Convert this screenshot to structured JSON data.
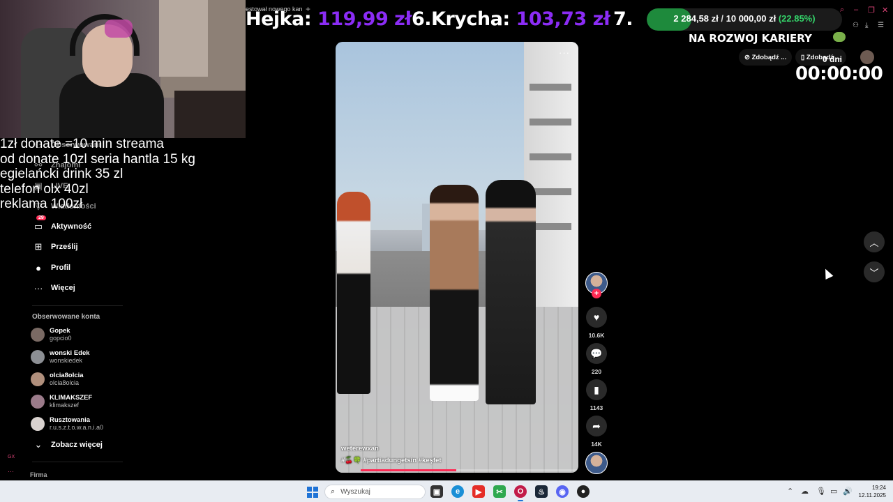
{
  "browser": {
    "tab_title": "estował nowego kan",
    "tab_add": "+"
  },
  "ticker": {
    "items": [
      {
        "name": "Hejka:",
        "amount": "119,99 zł"
      },
      {
        "name": "6.Krycha:",
        "amount": "103,73 zł"
      },
      {
        "name": "7.",
        "amount": ""
      }
    ],
    "goal": {
      "current": "2 284,58 zł",
      "separator": "/",
      "target": "10 000,00 zł",
      "percent_label": "(22.85%)",
      "progress": 0.2285,
      "caption": "NA ROZWOJ KARIERY"
    }
  },
  "donate_overlay": {
    "lines": [
      "1zł donate =10 min streama",
      "od donate 10zl seria hantla 15 kg",
      "egielańcki drink 35 zl",
      "telefon olx 40zl",
      "reklama 100zł"
    ]
  },
  "sidebar": {
    "nav": [
      {
        "label": "Obserwowani",
        "icon": "users-icon"
      },
      {
        "label": "Znajomi",
        "icon": "friends-icon"
      },
      {
        "label": "LIVE",
        "icon": "live-icon"
      },
      {
        "label": "Wiadomości",
        "icon": "messages-icon"
      },
      {
        "label": "Aktywność",
        "icon": "activity-icon",
        "badge": "29"
      },
      {
        "label": "Prześlij",
        "icon": "upload-icon"
      },
      {
        "label": "Profil",
        "icon": "profile-icon"
      },
      {
        "label": "Więcej",
        "icon": "more-icon"
      }
    ],
    "followed_title": "Obserwowane konta",
    "accounts": [
      {
        "name": "Gopek",
        "handle": "gopcio0"
      },
      {
        "name": "wonski Edek",
        "handle": "wonskiedek"
      },
      {
        "name": "olcia8olcia",
        "handle": "olcia8olcia"
      },
      {
        "name": "KLIMAKSZEF",
        "handle": "klimakszef"
      },
      {
        "name": "Rusztowania",
        "handle": "r.u.s.z.t.o.w.a.n.i.a0"
      }
    ],
    "see_more": "Zobacz więcej",
    "footer": "Firma",
    "left_strip_label": "GX"
  },
  "video": {
    "username": "weterewxan",
    "tags": "#🍒🍀 #partiadungetsin #keşfet",
    "more": "···",
    "progress": 0.44
  },
  "actions": {
    "likes": "10.6K",
    "comments": "220",
    "saves": "1143",
    "shares": "14K"
  },
  "right_panel": {
    "btn1": "Zdobądź ...",
    "btn2": "Zdobądź ...",
    "timer_label": "0 dni",
    "timer": "00:00:00"
  },
  "taskbar": {
    "search_placeholder": "Wyszukaj",
    "time": "19:24",
    "date": "12.11.2025"
  },
  "colors": {
    "accent_purple": "#8b2cf5",
    "goal_green": "#1e8a3c",
    "tiktok_red": "#fe2c55"
  }
}
